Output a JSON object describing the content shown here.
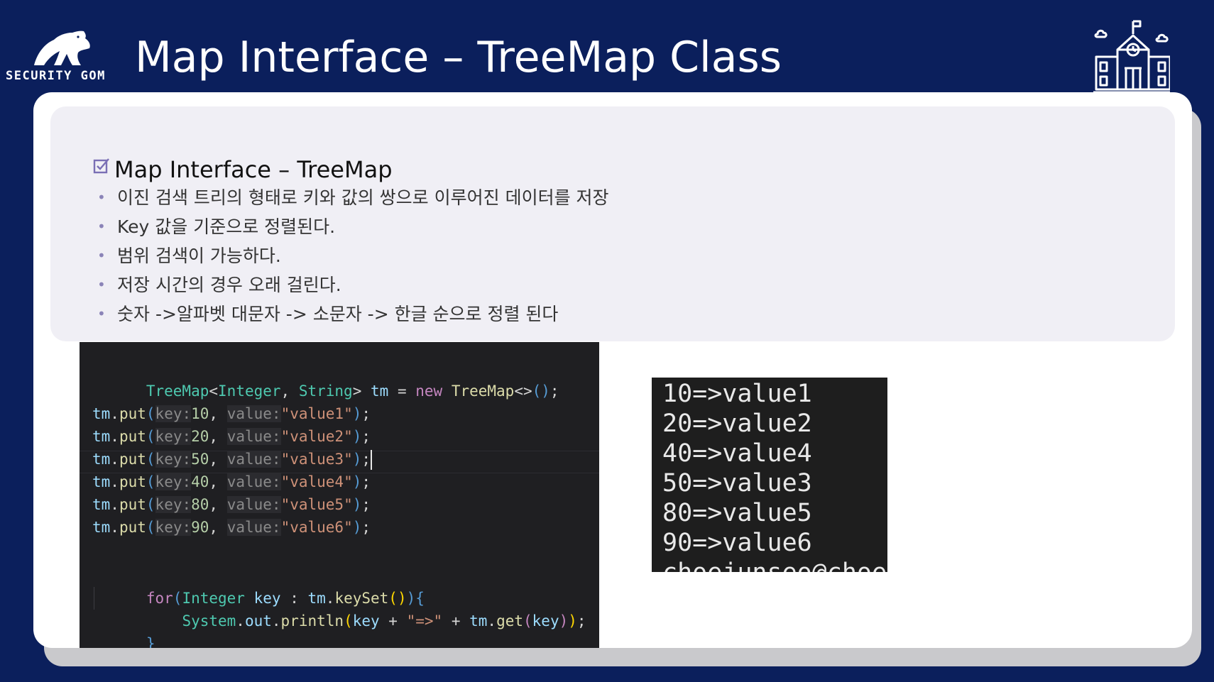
{
  "logo": {
    "text": "SECURITY GOM"
  },
  "title": "Map Interface – TreeMap Class",
  "section": {
    "heading": "Map  Interface – TreeMap",
    "bullets": [
      "이진 검색 트리의 형태로 키와 값의 쌍으로 이루어진 데이터를 저장",
      "Key 값을 기준으로 정렬된다.",
      "범위 검색이 가능하다.",
      "저장 시간의 경우 오래 걸린다.",
      "숫자 ->알파벳 대문자 -> 소문자 -> 한글 순으로 정렬 된다"
    ]
  },
  "code": {
    "decl": {
      "type": "TreeMap",
      "lt": "<",
      "generic1": "Integer",
      "comma": ", ",
      "generic2": "String",
      "gt": ">",
      "var": " tm",
      "eq": " = ",
      "new_kw": "new",
      "ctor": " TreeMap",
      "diamond": "<>",
      "parens": "()",
      "semi": ";"
    },
    "put_lines": [
      {
        "obj": "tm",
        "dot": ".",
        "method": "put",
        "open": "(",
        "key_hint": "key:",
        "key": "10",
        "comma": ", ",
        "value_hint": "value:",
        "value": "\"value1\"",
        "close": ")",
        "semi": ";"
      },
      {
        "obj": "tm",
        "dot": ".",
        "method": "put",
        "open": "(",
        "key_hint": "key:",
        "key": "20",
        "comma": ", ",
        "value_hint": "value:",
        "value": "\"value2\"",
        "close": ")",
        "semi": ";"
      },
      {
        "obj": "tm",
        "dot": ".",
        "method": "put",
        "open": "(",
        "key_hint": "key:",
        "key": "50",
        "comma": ", ",
        "value_hint": "value:",
        "value": "\"value3\"",
        "close": ")",
        "semi": ";"
      },
      {
        "obj": "tm",
        "dot": ".",
        "method": "put",
        "open": "(",
        "key_hint": "key:",
        "key": "40",
        "comma": ", ",
        "value_hint": "value:",
        "value": "\"value4\"",
        "close": ")",
        "semi": ";"
      },
      {
        "obj": "tm",
        "dot": ".",
        "method": "put",
        "open": "(",
        "key_hint": "key:",
        "key": "80",
        "comma": ", ",
        "value_hint": "value:",
        "value": "\"value5\"",
        "close": ")",
        "semi": ";"
      },
      {
        "obj": "tm",
        "dot": ".",
        "method": "put",
        "open": "(",
        "key_hint": "key:",
        "key": "90",
        "comma": ", ",
        "value_hint": "value:",
        "value": "\"value6\"",
        "close": ")",
        "semi": ";"
      }
    ],
    "for_line": {
      "kw": "for",
      "open": "(",
      "type": "Integer",
      "var": " key",
      "colon": " : ",
      "obj": "tm",
      "dot": ".",
      "method": "keySet",
      "call": "()",
      "close": ")",
      "brace": "{"
    },
    "print_line": {
      "indent": "    ",
      "cls": "System",
      "dot1": ".",
      "field": "out",
      "dot2": ".",
      "method": "println",
      "open": "(",
      "arg1": "key",
      "plus1": " + ",
      "str": "\"=>\"",
      "plus2": " + ",
      "obj": "tm",
      "dot3": ".",
      "get": "get",
      "get_open": "(",
      "arg2": "key",
      "get_close": ")",
      "close": ")",
      "semi": ";"
    },
    "close_brace": "}",
    "current_line": 3
  },
  "output": {
    "lines": [
      "10=>value1",
      "20=>value2",
      "40=>value4",
      "50=>value3",
      "80=>value5",
      "90=>value6"
    ],
    "cutoff_line": "choejunseo@choe"
  }
}
